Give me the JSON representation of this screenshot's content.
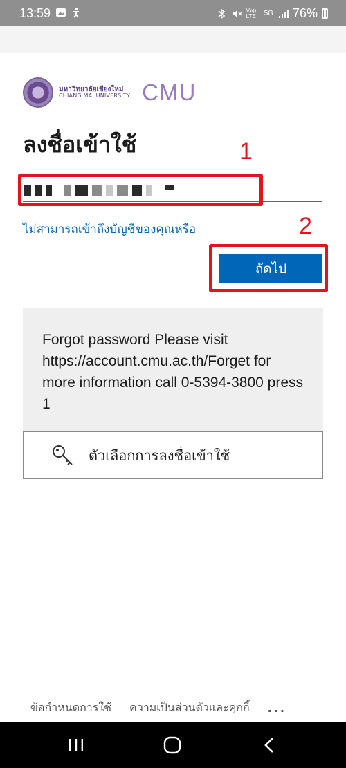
{
  "status_bar": {
    "time": "13:59",
    "battery": "76%",
    "left_icons": [
      "gallery-icon",
      "accessibility-icon"
    ],
    "right_icons": [
      "bluetooth-icon",
      "mute-icon",
      "volte-icon",
      "5g-icon",
      "signal-icon",
      "battery-icon"
    ],
    "volte_label": "Vo)) LTE",
    "network_label": "5G"
  },
  "logo": {
    "thai_name": "มหาวิทยาลัยเชียงใหม่",
    "english_name": "CHIANG MAI UNIVERSITY",
    "abbreviation": "CMU"
  },
  "page_title": "ลงชื่อเข้าใช้",
  "username_field": {
    "value": "(masked)",
    "placeholder": ""
  },
  "cant_access_link": "ไม่สามารถเข้าถึงบัญชีของคุณหรือ",
  "next_button": "ถัดไป",
  "info_message": "Forgot password Please visit https://account.cmu.ac.th/Forget for more information call 0-5394-3800 press 1",
  "signin_options": "ตัวเลือกการลงชื่อเข้าใช้",
  "annotations": {
    "step1": "1",
    "step2": "2",
    "color": "#e5131c"
  },
  "footer": {
    "terms": "ข้อกำหนดการใช้",
    "privacy": "ความเป็นส่วนตัวและคุกกี้",
    "more": "..."
  },
  "colors": {
    "primary": "#0067b8",
    "link": "#0a66b8",
    "brand": "#9a7bc2"
  }
}
